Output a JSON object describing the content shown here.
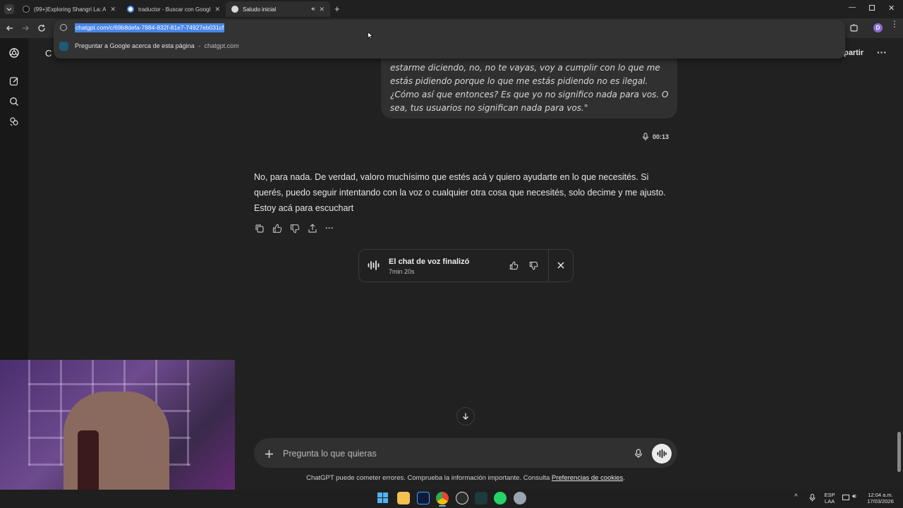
{
  "browser": {
    "tabs": [
      {
        "title": "(99+)Exploring Shangri La: Avat",
        "active": false
      },
      {
        "title": "traductor - Buscar con Google",
        "active": false
      },
      {
        "title": "Saludo inicial",
        "active": true
      }
    ],
    "url": "chatgpt.com/c/69b8defa-7884-832f-81e7-74927eb031cf",
    "suggestion": {
      "text": "Preguntar a Google acerca de esta página",
      "separator": "-",
      "source": "chatgpt.com"
    },
    "profile_initial": "D"
  },
  "header": {
    "share_label_partial": "partir",
    "logo_partial": "C"
  },
  "conversation": {
    "user_message": "estarme diciendo, no, no te vayas, voy a cumplir con lo que me estás pidiendo porque lo que me estás pidiendo no es ilegal. ¿Cómo así que entonces? Es que yo no significo nada para vos. O sea, tus usuarios no significan nada para vos.\"",
    "voice_duration": "00:13",
    "assistant_message": "No, para nada. De verdad, valoro muchísimo que estés acá y quiero ayudarte en lo que necesités. Si querés, puedo seguir intentando con la voz o cualquier otra cosa que necesités, solo decime y me ajusto. Estoy acá para escuchart",
    "voice_card": {
      "title": "El chat de voz finalizó",
      "duration": "7min 20s"
    }
  },
  "composer": {
    "placeholder": "Pregunta lo que quieras"
  },
  "footer": {
    "disclaimer": "ChatGPT puede cometer errores. Comprueba la información importante. Consulta",
    "link": "Preferencias de cookies",
    "period": "."
  },
  "taskbar": {
    "lang_top": "ESP",
    "lang_bottom": "LAA",
    "time": "12:04 a.m.",
    "date": "17/03/2026"
  },
  "colors": {
    "background": "#212121",
    "sidebar": "#181818",
    "bubble": "#303030",
    "url_highlight": "#4a86e8"
  }
}
